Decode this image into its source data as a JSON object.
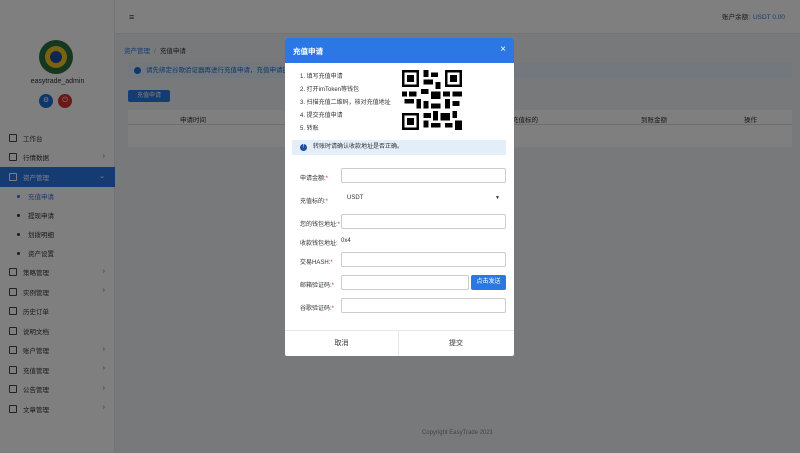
{
  "sidebar": {
    "username": "easytrade_admin",
    "menu": [
      {
        "label": "工作台",
        "chev": false
      },
      {
        "label": "行情数据",
        "chev": true
      },
      {
        "label": "资产管理",
        "chev": true,
        "active": true
      }
    ],
    "submenu": [
      {
        "label": "充值申请",
        "active": true
      },
      {
        "label": "提现申请",
        "active": false
      },
      {
        "label": "划拨明细",
        "active": false
      },
      {
        "label": "资产设置",
        "active": false
      }
    ],
    "menu2": [
      {
        "label": "策略管理"
      },
      {
        "label": "实例管理"
      },
      {
        "label": "历史订单"
      },
      {
        "label": "说明文档"
      },
      {
        "label": "账户管理"
      },
      {
        "label": "充值管理"
      },
      {
        "label": "公告管理"
      },
      {
        "label": "文章管理"
      }
    ]
  },
  "topbar": {
    "menu_icon": "≡",
    "assets_label": "账户余额:",
    "assets_value": "USDT 0.00"
  },
  "breadcrumb": {
    "parent": "资产管理",
    "separator": "/",
    "current": "充值申请"
  },
  "notice": "请先绑定谷歌验证器再进行充值申请，充值申请提交",
  "recharge_button": "充值申请",
  "table": {
    "headers": [
      "申请时间",
      "充值标的",
      "到账金额",
      "操作"
    ]
  },
  "footer": "Copyright EasyTrade 2021",
  "modal": {
    "title": "充值申请",
    "close": "×",
    "steps": [
      "1. 填写充值申请",
      "2. 打开imToken等钱包",
      "3. 扫描充值二维码，核对充值地址",
      "4. 提交充值申请",
      "5. 转账"
    ],
    "tip": "转账时请确认收款地址是否正确。",
    "fields": {
      "amount_label": "申请金额:",
      "asset_label": "充值标的:",
      "asset_value": "USDT",
      "wallet_label": "您的钱包地址:",
      "receive_label": "收款钱包地址:",
      "receive_value": "0x4",
      "hash_label": "交易HASH:",
      "email_code_label": "邮箱验证码:",
      "send_button": "点击发送",
      "google_code_label": "谷歌验证码:"
    },
    "cancel": "取消",
    "submit": "提交"
  }
}
